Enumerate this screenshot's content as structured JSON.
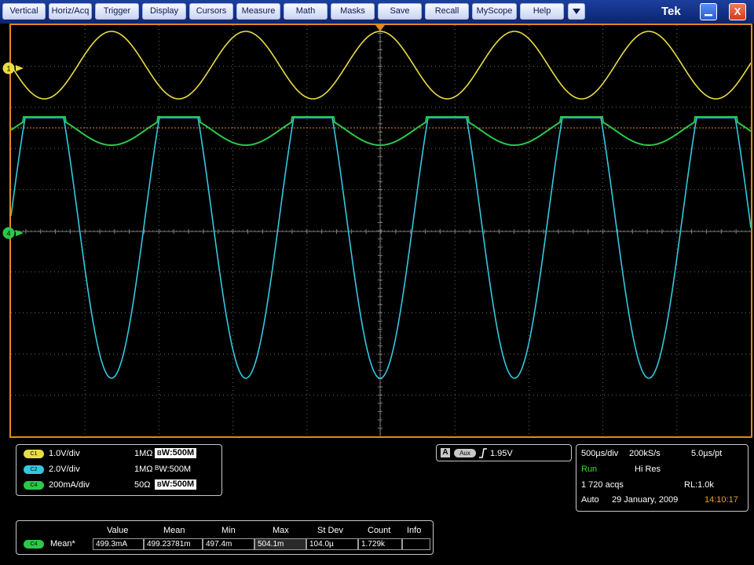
{
  "menu": {
    "items": [
      "Vertical",
      "Horiz/Acq",
      "Trigger",
      "Display",
      "Cursors",
      "Measure",
      "Math",
      "Masks",
      "Save",
      "Recall",
      "MyScope",
      "Help"
    ],
    "dropdown_icon": "chevron-down-icon",
    "brand": "Tek",
    "minimize_icon": "minimize-icon",
    "close_label": "X"
  },
  "markers": {
    "ch1": "1",
    "ch4": "4",
    "trigger_position_icon": "trigger-position-icon"
  },
  "colors": {
    "ch1": "#e8dc44",
    "ch2": "#34c8e0",
    "ch4": "#2cc84a",
    "frame": "#e08a1e",
    "timestamp": "#e8a030",
    "run": "#33dd33"
  },
  "channels": [
    {
      "badge": "C1",
      "scale": "1.0V/div",
      "impedance": "1MΩ",
      "bw_prefix": "B",
      "bw": "W:500M"
    },
    {
      "badge": "C2",
      "scale": "2.0V/div",
      "impedance": "1MΩ",
      "bw_prefix": "B",
      "bw": "W:500M"
    },
    {
      "badge": "C4",
      "scale": "200mA/div",
      "impedance": "50Ω",
      "bw_prefix": "B",
      "bw": "W:500M"
    }
  ],
  "trigger": {
    "badge": "A",
    "source": "Aux",
    "slope_icon": "rising-edge-icon",
    "level": "1.95V"
  },
  "acquisition": {
    "time_div": "500µs/div",
    "sample_rate": "200kS/s",
    "pt_interval": "5.0µs/pt",
    "state": "Run",
    "mode": "Hi Res",
    "acqs": "1 720 acqs",
    "record_length": "RL:1.0k",
    "trigger_mode": "Auto",
    "date": "29 January, 2009",
    "time": "14:10:17"
  },
  "measurements": {
    "headers": [
      "Value",
      "Mean",
      "Min",
      "Max",
      "St Dev",
      "Count",
      "Info"
    ],
    "rows": [
      {
        "badge": "C4",
        "label": "Mean*",
        "values": [
          "499.3mA",
          "499.23781m",
          "497.4m",
          "504.1m",
          "104.0µ",
          "1.729k",
          ""
        ]
      }
    ]
  }
}
